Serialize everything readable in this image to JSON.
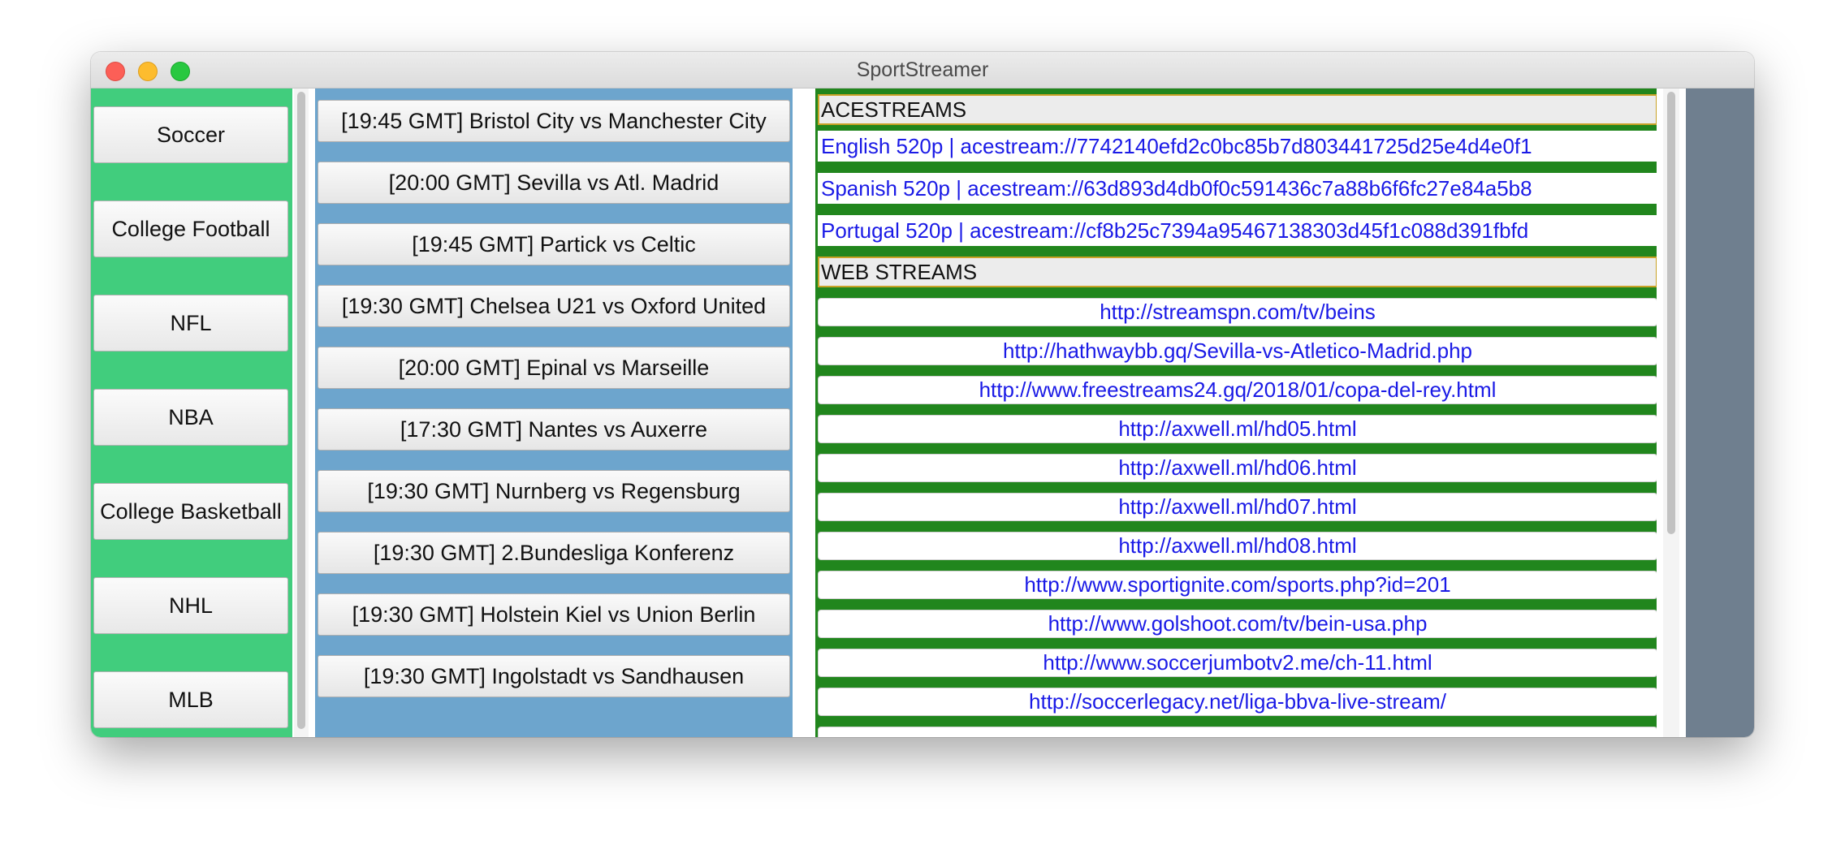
{
  "window": {
    "title": "SportStreamer"
  },
  "sports": [
    {
      "label": "Soccer",
      "selected": true
    },
    {
      "label": "College Football"
    },
    {
      "label": "NFL"
    },
    {
      "label": "NBA"
    },
    {
      "label": "College Basketball"
    },
    {
      "label": "NHL"
    },
    {
      "label": "MLB"
    }
  ],
  "matches": [
    "[19:45 GMT] Bristol City vs Manchester City",
    "[20:00 GMT] Sevilla vs Atl. Madrid",
    "[19:45 GMT] Partick vs Celtic",
    "[19:30 GMT] Chelsea U21 vs Oxford United",
    "[20:00 GMT] Epinal vs Marseille",
    "[17:30 GMT] Nantes vs Auxerre",
    "[19:30 GMT] Nurnberg vs Regensburg",
    "[19:30 GMT] 2.Bundesliga Konferenz",
    "[19:30 GMT] Holstein Kiel vs Union Berlin",
    "[19:30 GMT] Ingolstadt vs Sandhausen"
  ],
  "streams": {
    "acestreams_header": "ACESTREAMS",
    "acestreams": [
      "English 520p | acestream://7742140efd2c0bc85b7d803441725d25e4d4e0f1",
      "Spanish 520p | acestream://63d893d4db0f0c591436c7a88b6f6fc27e84a5b8",
      "Portugal 520p | acestream://cf8b25c7394a95467138303d45f1c088d391fbfd"
    ],
    "web_header": "WEB STREAMS",
    "web": [
      "http://streamspn.com/tv/beins",
      "http://hathwaybb.gq/Sevilla-vs-Atletico-Madrid.php",
      "http://www.freestreams24.gq/2018/01/copa-del-rey.html",
      "http://axwell.ml/hd05.html",
      "http://axwell.ml/hd06.html",
      "http://axwell.ml/hd07.html",
      "http://axwell.ml/hd08.html",
      "http://www.sportignite.com/sports.php?id=201",
      "http://www.golshoot.com/tv/bein-usa.php",
      "http://www.soccerjumbotv2.me/ch-11.html",
      "http://soccerlegacy.net/liga-bbva-live-stream/"
    ]
  },
  "colors": {
    "sports_bg": "#41cd7d",
    "matches_bg": "#6da5cd",
    "streams_bg": "#21861d",
    "link": "#1a1ae6",
    "right_pane": "#6f7f8f"
  }
}
